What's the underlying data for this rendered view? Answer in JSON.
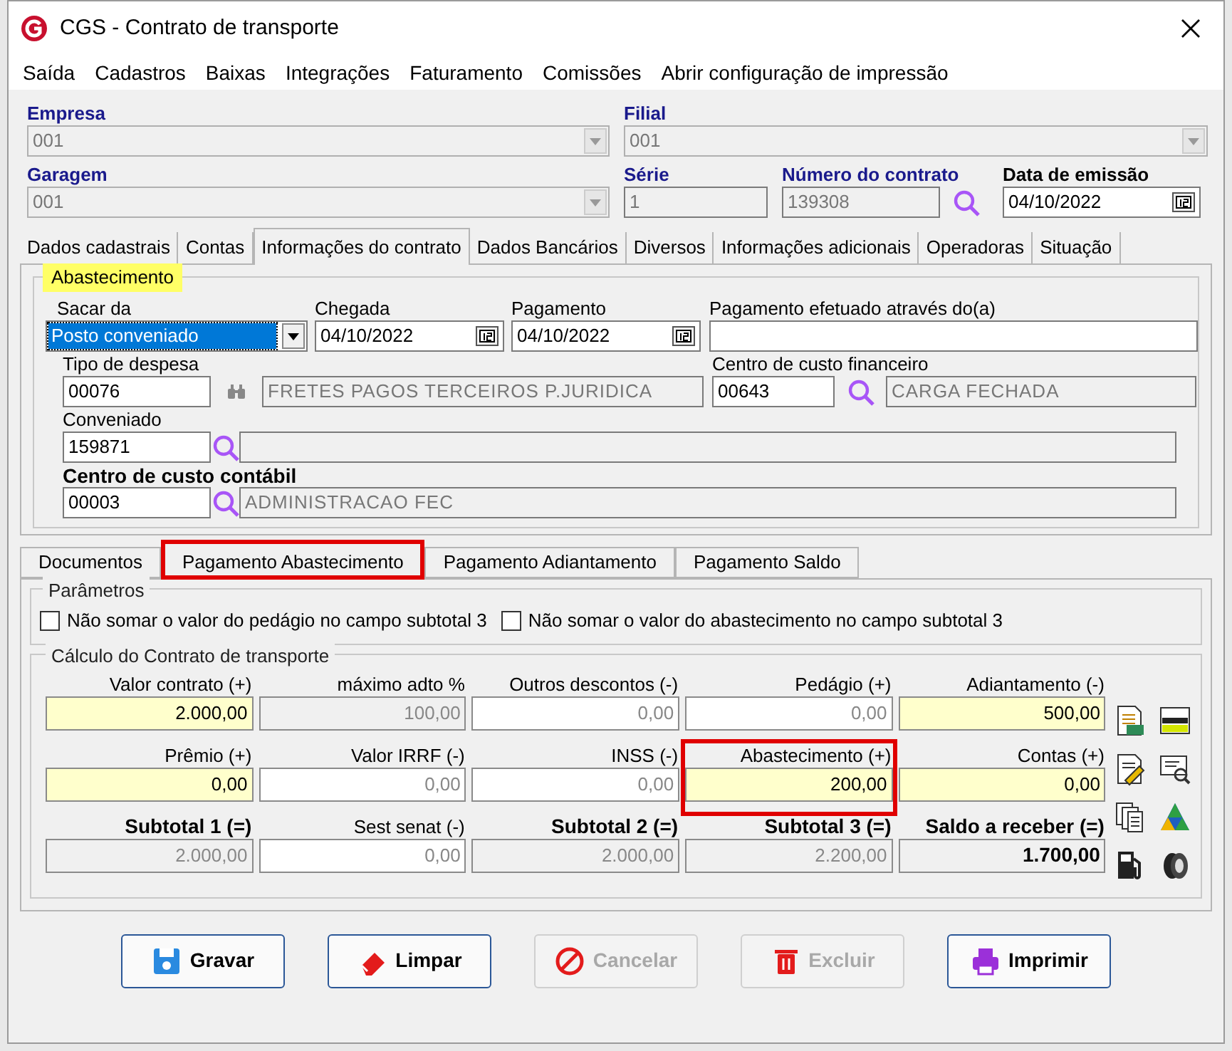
{
  "window": {
    "title": "CGS - Contrato de transporte"
  },
  "menu": [
    "Saída",
    "Cadastros",
    "Baixas",
    "Integrações",
    "Faturamento",
    "Comissões",
    "Abrir configuração de impressão"
  ],
  "header": {
    "empresa": {
      "label": "Empresa",
      "value": "001"
    },
    "filial": {
      "label": "Filial",
      "value": "001"
    },
    "garagem": {
      "label": "Garagem",
      "value": "001"
    },
    "serie": {
      "label": "Série",
      "value": "1"
    },
    "numero_contrato": {
      "label": "Número do contrato",
      "value": "139308"
    },
    "data_emissao": {
      "label": "Data de emissão",
      "value": "04/10/2022"
    }
  },
  "tabs": [
    {
      "label": "Dados cadastrais",
      "selected": false
    },
    {
      "label": "Contas",
      "selected": false
    },
    {
      "label": "Informações do contrato",
      "selected": true
    },
    {
      "label": "Dados Bancários",
      "selected": false
    },
    {
      "label": "Diversos",
      "selected": false
    },
    {
      "label": "Informações adicionais",
      "selected": false
    },
    {
      "label": "Operadoras",
      "selected": false
    },
    {
      "label": "Situação",
      "selected": false
    }
  ],
  "abastecimento": {
    "title": "Abastecimento",
    "title_highlighted": true,
    "sacar_da": {
      "label": "Sacar da",
      "value": "Posto conveniado"
    },
    "chegada": {
      "label": "Chegada",
      "value": "04/10/2022"
    },
    "pagamento": {
      "label": "Pagamento",
      "value": "04/10/2022"
    },
    "pagamento_efetuado": {
      "label": "Pagamento efetuado através do(a)"
    },
    "tipo_despesa": {
      "label": "Tipo de despesa",
      "code": "00076",
      "description": "FRETES PAGOS TERCEIROS P.JURIDICA"
    },
    "centro_custo_financeiro": {
      "label": "Centro de custo financeiro",
      "code": "00643",
      "description": "CARGA FECHADA"
    },
    "conveniado": {
      "label": "Conveniado",
      "code": "159871"
    },
    "centro_custo_contabil": {
      "label": "Centro de custo contábil",
      "code": "00003",
      "description": "ADMINISTRACAO FEC"
    }
  },
  "subtabs": [
    {
      "label": "Documentos",
      "selected": false,
      "highlighted": false
    },
    {
      "label": "Pagamento Abastecimento",
      "selected": true,
      "highlighted": true
    },
    {
      "label": "Pagamento Adiantamento",
      "selected": false,
      "highlighted": false
    },
    {
      "label": "Pagamento Saldo",
      "selected": false,
      "highlighted": false
    }
  ],
  "parametros": {
    "title": "Parâmetros",
    "options": [
      {
        "label": "Não somar o valor do pedágio no campo subtotal 3",
        "checked": false
      },
      {
        "label": "Não somar o valor do abastecimento no campo subtotal 3",
        "checked": false
      }
    ]
  },
  "calculo": {
    "title": "Cálculo do Contrato de transporte",
    "fields": [
      {
        "label": "Valor contrato (+)",
        "value": "2.000,00",
        "kind": "editable",
        "bold": false,
        "highlighted": false
      },
      {
        "label": "máximo adto %",
        "value": "100,00",
        "kind": "readonly",
        "bold": false,
        "highlighted": false
      },
      {
        "label": "Outros descontos (-)",
        "value": "0,00",
        "kind": "input",
        "bold": false,
        "highlighted": false
      },
      {
        "label": "Pedágio (+)",
        "value": "0,00",
        "kind": "input",
        "bold": false,
        "highlighted": false
      },
      {
        "label": "Adiantamento (-)",
        "value": "500,00",
        "kind": "editable",
        "bold": false,
        "highlighted": false
      },
      {
        "label": "Prêmio (+)",
        "value": "0,00",
        "kind": "editable",
        "bold": false,
        "highlighted": false
      },
      {
        "label": "Valor IRRF (-)",
        "value": "0,00",
        "kind": "input",
        "bold": false,
        "highlighted": false
      },
      {
        "label": "INSS (-)",
        "value": "0,00",
        "kind": "input",
        "bold": false,
        "highlighted": false
      },
      {
        "label": "Abastecimento (+)",
        "value": "200,00",
        "kind": "editable",
        "bold": false,
        "highlighted": true
      },
      {
        "label": "Contas (+)",
        "value": "0,00",
        "kind": "editable",
        "bold": false,
        "highlighted": false
      },
      {
        "label": "Subtotal 1 (=)",
        "value": "2.000,00",
        "kind": "readonly",
        "bold": true,
        "highlighted": false
      },
      {
        "label": "Sest senat (-)",
        "value": "0,00",
        "kind": "input",
        "bold": false,
        "highlighted": false
      },
      {
        "label": "Subtotal 2 (=)",
        "value": "2.000,00",
        "kind": "readonly",
        "bold": true,
        "highlighted": false
      },
      {
        "label": "Subtotal 3 (=)",
        "value": "2.200,00",
        "kind": "readonly",
        "bold": true,
        "highlighted": false
      },
      {
        "label": "Saldo a receber (=)",
        "value": "1.700,00",
        "kind": "total",
        "bold": true,
        "highlighted": false
      }
    ]
  },
  "buttons": [
    {
      "label": "Gravar",
      "kind": "save",
      "disabled": false
    },
    {
      "label": "Limpar",
      "kind": "clear",
      "disabled": false
    },
    {
      "label": "Cancelar",
      "kind": "cancel",
      "disabled": true
    },
    {
      "label": "Excluir",
      "kind": "delete",
      "disabled": true
    },
    {
      "label": "Imprimir",
      "kind": "print",
      "disabled": false
    }
  ]
}
